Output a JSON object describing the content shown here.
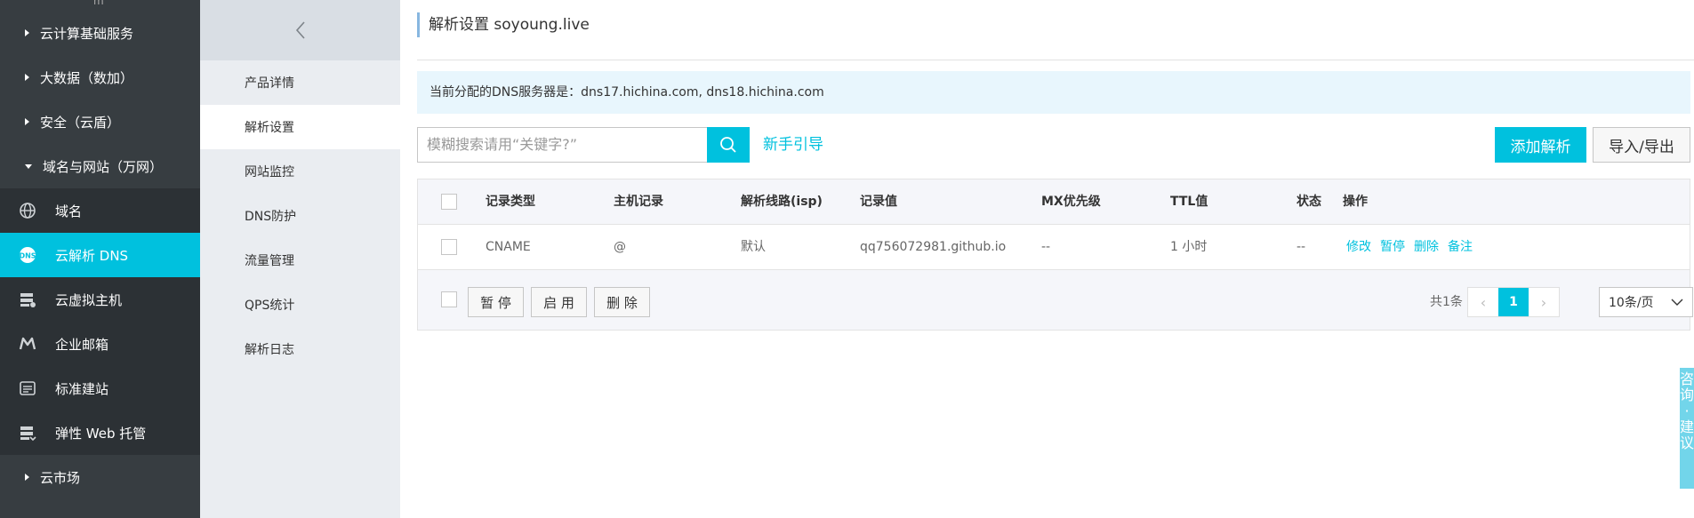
{
  "sidebar": {
    "top_stub": "m",
    "groups_top": [
      {
        "label": "云计算基础服务"
      },
      {
        "label": "大数据（数加）"
      },
      {
        "label": "安全（云盾）"
      },
      {
        "label": "域名与网站（万网）"
      }
    ],
    "items": [
      {
        "label": "域名",
        "icon": "globe-icon"
      },
      {
        "label": "云解析 DNS",
        "icon": "dns-icon"
      },
      {
        "label": "云虚拟主机",
        "icon": "server-icon"
      },
      {
        "label": "企业邮箱",
        "icon": "mail-m-icon"
      },
      {
        "label": "标准建站",
        "icon": "website-icon"
      },
      {
        "label": "弹性 Web 托管",
        "icon": "web-hosting-icon"
      }
    ],
    "groups_bottom": [
      {
        "label": "云市场"
      }
    ]
  },
  "subnav": {
    "items": [
      {
        "label": "产品详情"
      },
      {
        "label": "解析设置"
      },
      {
        "label": "网站监控"
      },
      {
        "label": "DNS防护"
      },
      {
        "label": "流量管理"
      },
      {
        "label": "QPS统计"
      },
      {
        "label": "解析日志"
      }
    ]
  },
  "main": {
    "title": "解析设置 soyoung.live",
    "notice": "当前分配的DNS服务器是：dns17.hichina.com, dns18.hichina.com",
    "search_placeholder": "模糊搜索请用“关键字?”",
    "guide_link": "新手引导",
    "add_button": "添加解析",
    "import_export_button": "导入/导出",
    "colors": {
      "accent": "#00c1de",
      "sidebar": "#373d41"
    }
  },
  "table": {
    "headers": [
      "记录类型",
      "主机记录",
      "解析线路(isp)",
      "记录值",
      "MX优先级",
      "TTL值",
      "状态",
      "操作"
    ],
    "rows": [
      {
        "type": "CNAME",
        "host": "@",
        "line": "默认",
        "value": "qq756072981.github.io",
        "mx": "--",
        "ttl": "1 小时",
        "status": "--",
        "ops": [
          "修改",
          "暂停",
          "删除",
          "备注"
        ]
      }
    ],
    "footer": {
      "pause": "暂 停",
      "enable": "启 用",
      "delete": "删 除",
      "total": "共1条",
      "current_page": "1",
      "page_size": "10条/页"
    }
  },
  "float_tab": {
    "chars": [
      "咨",
      "询",
      "·",
      "建",
      "议"
    ]
  }
}
